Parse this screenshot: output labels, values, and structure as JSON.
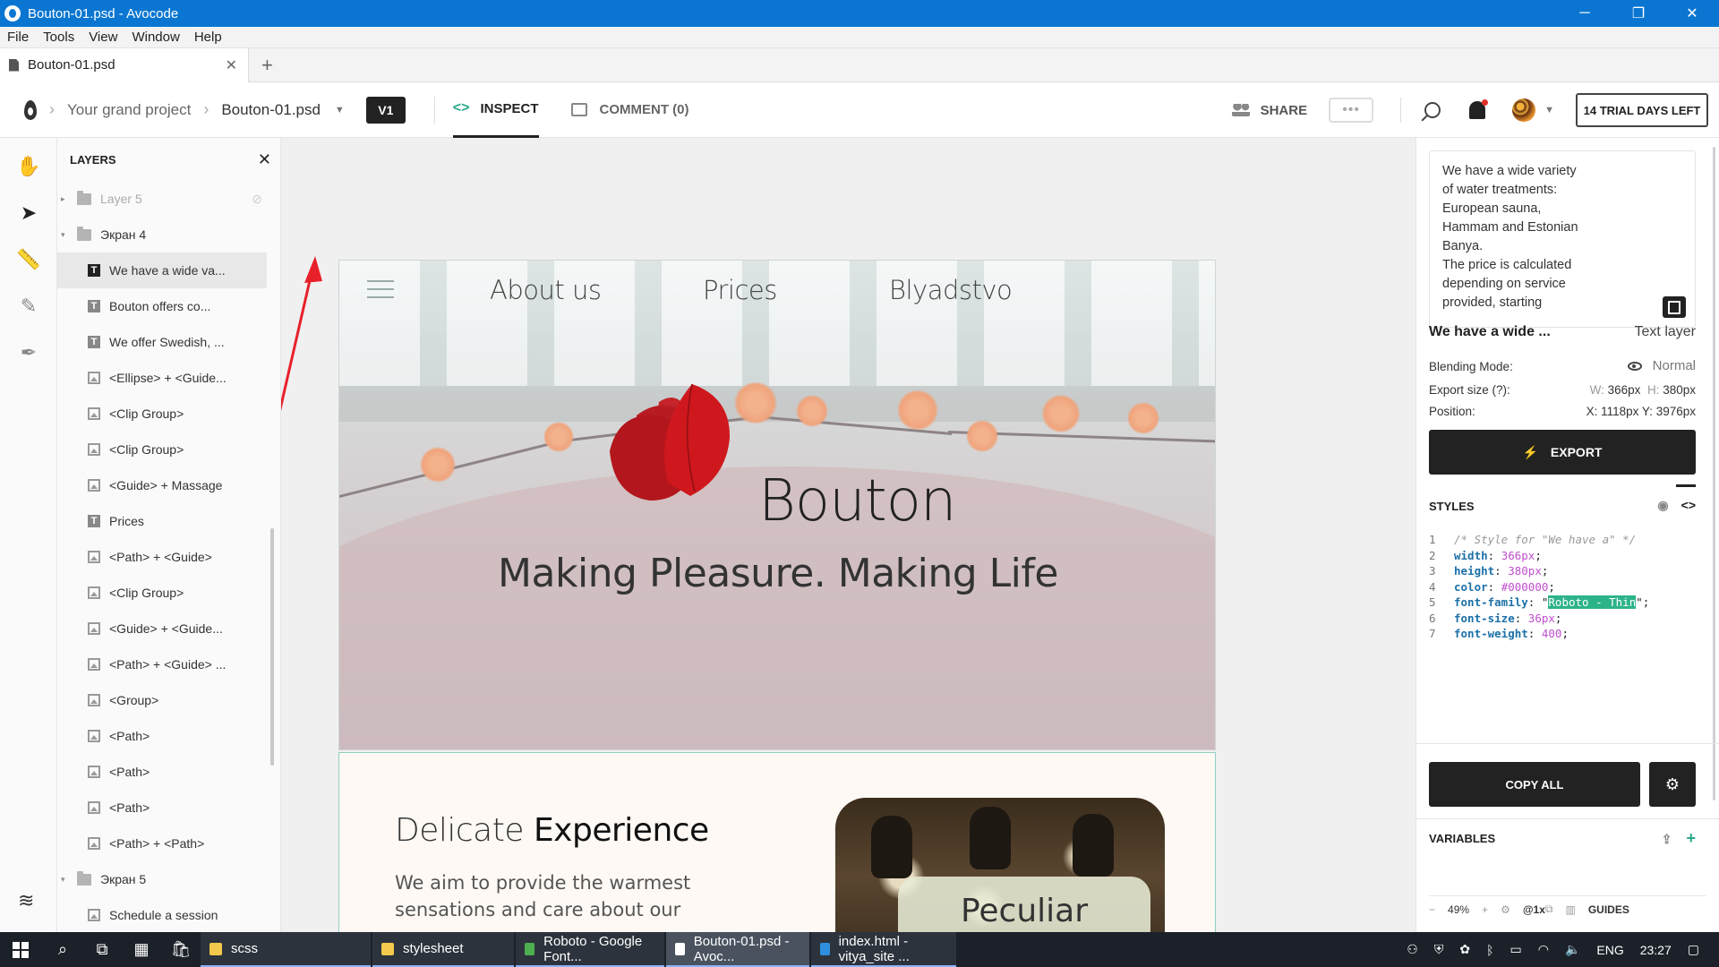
{
  "window": {
    "title": "Bouton-01.psd - Avocode",
    "controls": [
      "─",
      "❐",
      "✕"
    ]
  },
  "menu": [
    "File",
    "Tools",
    "View",
    "Window",
    "Help"
  ],
  "tab": {
    "label": "Bouton-01.psd",
    "close": "✕",
    "add": "+"
  },
  "toolbar": {
    "project": "Your grand project",
    "file": "Bouton-01.psd",
    "version": "V1",
    "inspect": "INSPECT",
    "comment": "COMMENT (0)",
    "share": "SHARE",
    "more": "•••",
    "trial": "14 TRIAL DAYS LEFT"
  },
  "layers": {
    "title": "LAYERS",
    "close": "✕",
    "items": [
      {
        "label": "Layer 5",
        "type": "folder",
        "indent": 0,
        "dim": true,
        "arrow": "▸"
      },
      {
        "label": "Экран 4",
        "type": "folder",
        "indent": 0,
        "arrow": "▾"
      },
      {
        "label": "We have a wide va...",
        "type": "text",
        "indent": 1,
        "selected": true
      },
      {
        "label": "Bouton offers co...",
        "type": "text",
        "indent": 1
      },
      {
        "label": "We offer Swedish, ...",
        "type": "text",
        "indent": 1
      },
      {
        "label": "<Ellipse> + <Guide...",
        "type": "image",
        "indent": 1
      },
      {
        "label": "<Clip Group>",
        "type": "image",
        "indent": 1
      },
      {
        "label": "<Clip Group>",
        "type": "image",
        "indent": 1
      },
      {
        "label": "<Guide> + Massage",
        "type": "image",
        "indent": 1
      },
      {
        "label": "Prices",
        "type": "text",
        "indent": 1
      },
      {
        "label": "<Path> + <Guide>",
        "type": "image",
        "indent": 1
      },
      {
        "label": "<Clip Group>",
        "type": "image",
        "indent": 1
      },
      {
        "label": "<Guide> + <Guide...",
        "type": "image",
        "indent": 1
      },
      {
        "label": "<Path> + <Guide> ...",
        "type": "image",
        "indent": 1
      },
      {
        "label": "<Group>",
        "type": "image",
        "indent": 1
      },
      {
        "label": "<Path>",
        "type": "image",
        "indent": 1
      },
      {
        "label": "<Path>",
        "type": "image",
        "indent": 1
      },
      {
        "label": "<Path>",
        "type": "image",
        "indent": 1
      },
      {
        "label": "<Path> + <Path>",
        "type": "image",
        "indent": 1
      },
      {
        "label": "Экран 5",
        "type": "folder",
        "indent": 0,
        "arrow": "▾"
      },
      {
        "label": "Schedule a session",
        "type": "image",
        "indent": 1
      }
    ]
  },
  "design": {
    "nav": [
      "About us",
      "Prices",
      "Blyadstvo"
    ],
    "brand": "Bouton",
    "tagline": "Making Pleasure. Making Life",
    "heading_light": "Delicate ",
    "heading_bold": "Experience",
    "body": "We aim to provide the warmest sensations and care about our",
    "card": "Peculiar"
  },
  "inspector": {
    "preview_lines": [
      "We have a wide variety",
      "of water treatments:",
      "European sauna,",
      "Hammam and Estonian",
      "Banya.",
      "The price is calculated",
      "depending on service",
      "provided, starting"
    ],
    "layer_name": "We have a wide ...",
    "layer_type": "Text layer",
    "blending_label": "Blending Mode:",
    "blending_value": "Normal",
    "export_label": "Export size (?):",
    "w_label": "W:",
    "w_value": "366px",
    "h_label": "H:",
    "h_value": "380px",
    "position_label": "Position:",
    "x_label": "X:",
    "x_value": "1118px",
    "y_label": "Y:",
    "y_value": "3976px",
    "export_btn": "EXPORT",
    "styles_title": "STYLES",
    "code": [
      {
        "n": "1",
        "comment": "/* Style for \"We have a\" */"
      },
      {
        "n": "2",
        "prop": "width",
        "val": "366px"
      },
      {
        "n": "3",
        "prop": "height",
        "val": "380px"
      },
      {
        "n": "4",
        "prop": "color",
        "val": "#000000"
      },
      {
        "n": "5",
        "prop": "font-family",
        "val": "Roboto - Thin",
        "quoted": true
      },
      {
        "n": "6",
        "prop": "font-size",
        "val": "36px"
      },
      {
        "n": "7",
        "prop": "font-weight",
        "val": "400"
      }
    ],
    "copy_all": "COPY ALL",
    "variables": "VARIABLES",
    "zoom_minus": "−",
    "zoom": "49%",
    "zoom_plus": "+",
    "scale": "@1x",
    "guides": "GUIDES"
  },
  "taskbar": {
    "items": [
      {
        "label": "scss",
        "color": "#f2c94c"
      },
      {
        "label": "stylesheet",
        "color": "#f2c94c"
      },
      {
        "label": "Roboto - Google Font...",
        "color": "#4caf50"
      },
      {
        "label": "Bouton-01.psd - Avoc...",
        "color": "#ffffff",
        "active": true
      },
      {
        "label": "index.html - vitya_site ...",
        "color": "#2f8fde"
      }
    ],
    "lang": "ENG",
    "time": "23:27"
  },
  "colors": {
    "titlebar": "#0a76d1",
    "accent": "#2aa88a",
    "logo_red": "#c0161b",
    "annotation_red": "#e8202a"
  }
}
